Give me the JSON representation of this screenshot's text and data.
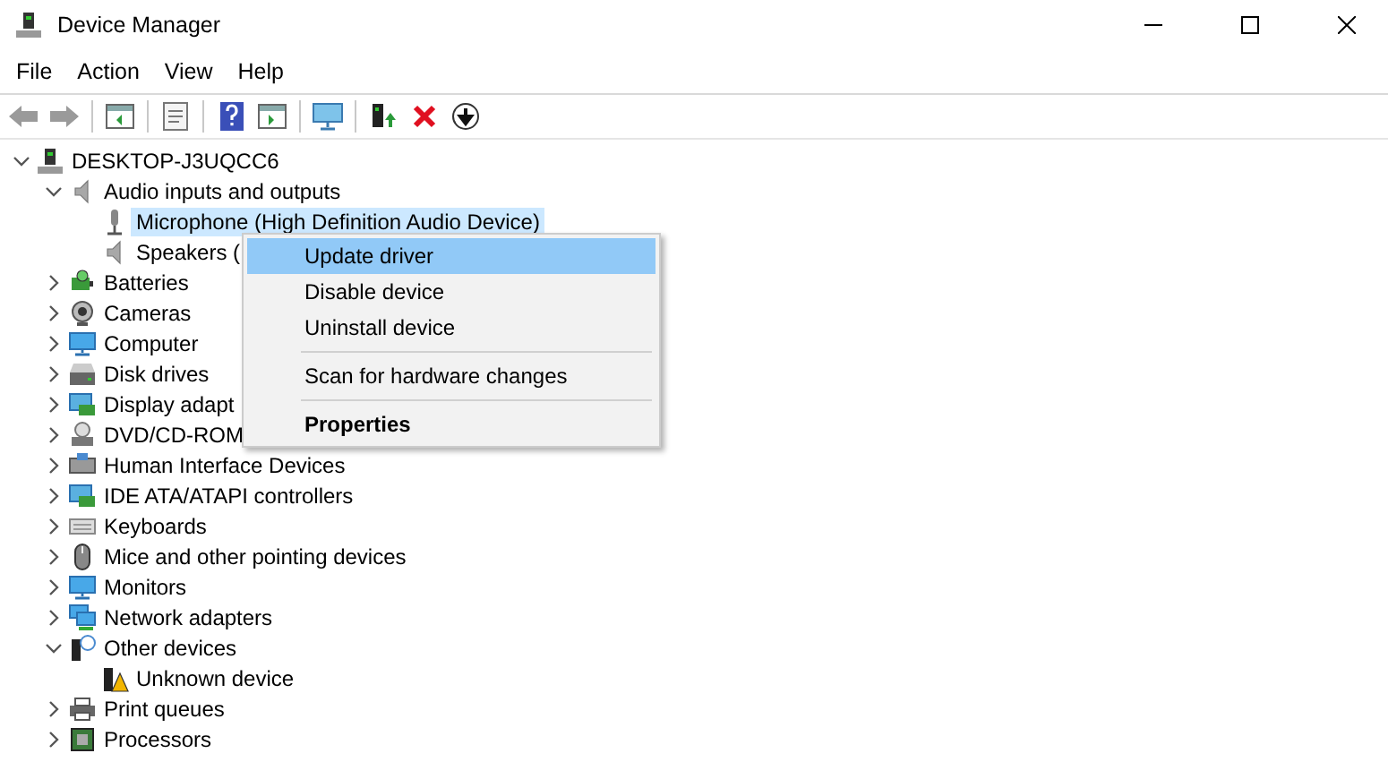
{
  "window": {
    "title": "Device Manager"
  },
  "menu": [
    "File",
    "Action",
    "View",
    "Help"
  ],
  "toolbar": [
    {
      "kind": "back",
      "disabled": true
    },
    {
      "kind": "forward",
      "disabled": true
    },
    {
      "kind": "separator"
    },
    {
      "kind": "console"
    },
    {
      "kind": "separator"
    },
    {
      "kind": "properties"
    },
    {
      "kind": "separator"
    },
    {
      "kind": "help"
    },
    {
      "kind": "pane"
    },
    {
      "kind": "separator"
    },
    {
      "kind": "scan"
    },
    {
      "kind": "separator"
    },
    {
      "kind": "update"
    },
    {
      "kind": "uninstall"
    },
    {
      "kind": "disable"
    }
  ],
  "tree": [
    {
      "label": "DESKTOP-J3UQCC6",
      "kind": "computer",
      "expanded": true,
      "selected": false,
      "children": [
        {
          "label": "Audio inputs and outputs",
          "kind": "speaker",
          "expanded": true,
          "selected": false,
          "children": [
            {
              "label": "Microphone (High Definition Audio Device)",
              "kind": "mic",
              "selected": true
            },
            {
              "label": "Speakers (",
              "kind": "speaker",
              "selected": false
            }
          ]
        },
        {
          "label": "Batteries",
          "kind": "battery",
          "expanded": false,
          "selected": false
        },
        {
          "label": "Cameras",
          "kind": "camera",
          "expanded": false,
          "selected": false
        },
        {
          "label": "Computer",
          "kind": "monitor",
          "expanded": false,
          "selected": false
        },
        {
          "label": "Disk drives",
          "kind": "disk",
          "expanded": false,
          "selected": false
        },
        {
          "label": "Display adapt",
          "kind": "display",
          "expanded": false,
          "selected": false
        },
        {
          "label": "DVD/CD-ROM",
          "kind": "dvd",
          "expanded": false,
          "selected": false
        },
        {
          "label": "Human Interface Devices",
          "kind": "hid",
          "expanded": false,
          "selected": false
        },
        {
          "label": "IDE ATA/ATAPI controllers",
          "kind": "display",
          "expanded": false,
          "selected": false
        },
        {
          "label": "Keyboards",
          "kind": "keyboard",
          "expanded": false,
          "selected": false
        },
        {
          "label": "Mice and other pointing devices",
          "kind": "mouse",
          "expanded": false,
          "selected": false
        },
        {
          "label": "Monitors",
          "kind": "monitor",
          "expanded": false,
          "selected": false
        },
        {
          "label": "Network adapters",
          "kind": "network",
          "expanded": false,
          "selected": false
        },
        {
          "label": "Other devices",
          "kind": "unknown",
          "expanded": true,
          "selected": false,
          "children": [
            {
              "label": "Unknown device",
              "kind": "warning",
              "selected": false
            }
          ]
        },
        {
          "label": "Print queues",
          "kind": "printer",
          "expanded": false,
          "selected": false
        },
        {
          "label": "Processors",
          "kind": "cpu",
          "expanded": false,
          "selected": false
        }
      ]
    }
  ],
  "context_menu": [
    {
      "kind": "item",
      "label": "Update driver",
      "selected": true,
      "default": false
    },
    {
      "kind": "item",
      "label": "Disable device",
      "selected": false,
      "default": false
    },
    {
      "kind": "item",
      "label": "Uninstall device",
      "selected": false,
      "default": false
    },
    {
      "kind": "separator"
    },
    {
      "kind": "item",
      "label": "Scan for hardware changes",
      "selected": false,
      "default": false
    },
    {
      "kind": "separator"
    },
    {
      "kind": "item",
      "label": "Properties",
      "selected": false,
      "default": true
    }
  ]
}
